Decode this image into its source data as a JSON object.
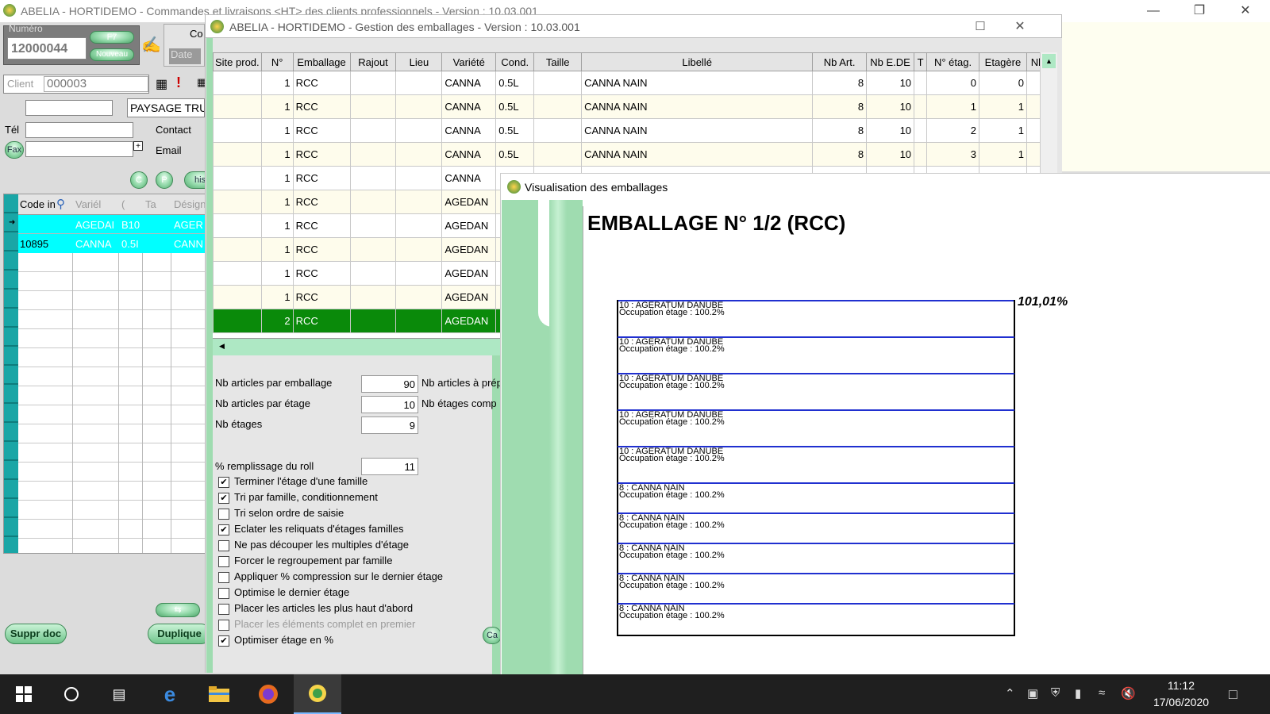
{
  "main_window": {
    "title": "ABELIA  -  HORTIDEMO  -  Commandes et livraisons <HT> des clients professionnels  -  Version : 10.03.001",
    "numero_label": "Numéro",
    "numero_value": "12000044",
    "f7_button": "F7",
    "nouveau_button": "Nouveau",
    "co_label": "Co",
    "date_label": "Date",
    "client_label": "Client",
    "client_value": "000003",
    "client_name": "PAYSAGE TRU",
    "tel_label": "Tél",
    "contact_label": "Contact",
    "fax_label": "Fax",
    "email_label": "Email",
    "c_button": "C",
    "p_button": "P",
    "his_button": "his",
    "grid": {
      "columns": [
        "Code in",
        "Variél",
        "(",
        "Ta",
        "Désign"
      ],
      "rows": [
        [
          "",
          "AGEDAI",
          "B10",
          "",
          "AGER"
        ],
        [
          "10895",
          "CANNA",
          "0.5I",
          "",
          "CANN"
        ]
      ]
    },
    "suppr_button": "Suppr doc",
    "duplique_button": "Duplique"
  },
  "gestion_window": {
    "title": "ABELIA  -  HORTIDEMO  -  Gestion des emballages  -  Version : 10.03.001",
    "columns": [
      "Site prod.",
      "N°",
      "Emballage",
      "Rajout",
      "Lieu",
      "Variété",
      "Cond.",
      "Taille",
      "Libellé",
      "Nb Art.",
      "Nb E.DE",
      "T",
      "N° étag.",
      "Etagère",
      "Nb/e"
    ],
    "rows": [
      {
        "site": "",
        "n": "1",
        "emb": "RCC",
        "rajout": "",
        "lieu": "",
        "var": "CANNA",
        "cond": "0.5L",
        "taille": "",
        "lib": "CANNA NAIN",
        "nbart": "8",
        "nbede": "10",
        "t": "",
        "netag": "0",
        "etag": "0",
        "nbe": ""
      },
      {
        "site": "",
        "n": "1",
        "emb": "RCC",
        "rajout": "",
        "lieu": "",
        "var": "CANNA",
        "cond": "0.5L",
        "taille": "",
        "lib": "CANNA NAIN",
        "nbart": "8",
        "nbede": "10",
        "t": "",
        "netag": "1",
        "etag": "1",
        "nbe": ""
      },
      {
        "site": "",
        "n": "1",
        "emb": "RCC",
        "rajout": "",
        "lieu": "",
        "var": "CANNA",
        "cond": "0.5L",
        "taille": "",
        "lib": "CANNA NAIN",
        "nbart": "8",
        "nbede": "10",
        "t": "",
        "netag": "2",
        "etag": "1",
        "nbe": ""
      },
      {
        "site": "",
        "n": "1",
        "emb": "RCC",
        "rajout": "",
        "lieu": "",
        "var": "CANNA",
        "cond": "0.5L",
        "taille": "",
        "lib": "CANNA NAIN",
        "nbart": "8",
        "nbede": "10",
        "t": "",
        "netag": "3",
        "etag": "1",
        "nbe": ""
      },
      {
        "site": "",
        "n": "1",
        "emb": "RCC",
        "rajout": "",
        "lieu": "",
        "var": "CANNA",
        "cond": "",
        "taille": "",
        "lib": "",
        "nbart": "",
        "nbede": "",
        "t": "",
        "netag": "",
        "etag": "",
        "nbe": ""
      },
      {
        "site": "",
        "n": "1",
        "emb": "RCC",
        "rajout": "",
        "lieu": "",
        "var": "AGEDAN",
        "cond": "",
        "taille": "",
        "lib": "",
        "nbart": "",
        "nbede": "",
        "t": "",
        "netag": "",
        "etag": "",
        "nbe": ""
      },
      {
        "site": "",
        "n": "1",
        "emb": "RCC",
        "rajout": "",
        "lieu": "",
        "var": "AGEDAN",
        "cond": "",
        "taille": "",
        "lib": "",
        "nbart": "",
        "nbede": "",
        "t": "",
        "netag": "",
        "etag": "",
        "nbe": ""
      },
      {
        "site": "",
        "n": "1",
        "emb": "RCC",
        "rajout": "",
        "lieu": "",
        "var": "AGEDAN",
        "cond": "",
        "taille": "",
        "lib": "",
        "nbart": "",
        "nbede": "",
        "t": "",
        "netag": "",
        "etag": "",
        "nbe": ""
      },
      {
        "site": "",
        "n": "1",
        "emb": "RCC",
        "rajout": "",
        "lieu": "",
        "var": "AGEDAN",
        "cond": "",
        "taille": "",
        "lib": "",
        "nbart": "",
        "nbede": "",
        "t": "",
        "netag": "",
        "etag": "",
        "nbe": ""
      },
      {
        "site": "",
        "n": "1",
        "emb": "RCC",
        "rajout": "",
        "lieu": "",
        "var": "AGEDAN",
        "cond": "",
        "taille": "",
        "lib": "",
        "nbart": "",
        "nbede": "",
        "t": "",
        "netag": "",
        "etag": "",
        "nbe": ""
      },
      {
        "site": "",
        "n": "2",
        "emb": "RCC",
        "rajout": "",
        "lieu": "",
        "var": "AGEDAN",
        "cond": "",
        "taille": "",
        "lib": "",
        "nbart": "",
        "nbede": "",
        "t": "",
        "netag": "",
        "etag": "",
        "nbe": ""
      }
    ],
    "params": {
      "nb_articles_par_emballage_label": "Nb articles par emballage",
      "nb_articles_par_emballage": "90",
      "nb_articles_par_etage_label": "Nb articles par étage",
      "nb_articles_par_etage": "10",
      "nb_etages_label": "Nb étages",
      "nb_etages": "9",
      "nb_articles_a_prep_label": "Nb articles à prép",
      "nb_etages_comp_label": "Nb étages comp",
      "remplissage_label": "% remplissage du roll",
      "remplissage": "11"
    },
    "checkboxes": [
      {
        "label": "Terminer l'étage d'une famille",
        "checked": true,
        "disabled": false
      },
      {
        "label": "Tri par famille, conditionnement",
        "checked": true,
        "disabled": false
      },
      {
        "label": "Tri selon ordre de saisie",
        "checked": false,
        "disabled": false
      },
      {
        "label": "Eclater les reliquats d'étages familles",
        "checked": true,
        "disabled": false
      },
      {
        "label": "Ne pas découper les multiples d'étage",
        "checked": false,
        "disabled": false
      },
      {
        "label": "Forcer le regroupement par famille",
        "checked": false,
        "disabled": false
      },
      {
        "label": "Appliquer % compression sur le dernier étage",
        "checked": false,
        "disabled": false
      },
      {
        "label": "Optimise le dernier étage",
        "checked": false,
        "disabled": false
      },
      {
        "label": "Placer les articles les plus haut d'abord",
        "checked": false,
        "disabled": false
      },
      {
        "label": "Placer les éléments complet en premier",
        "checked": false,
        "disabled": true
      },
      {
        "label": "Optimiser étage en %",
        "checked": true,
        "disabled": false
      }
    ],
    "ca_button": "Ca"
  },
  "visualisation_window": {
    "title": "Visualisation des emballages",
    "heading": "EMBALLAGE N° 1/2 (RCC)",
    "percent": "101,01%",
    "shelves": [
      {
        "article": "10 : AGERATUM DANUBE",
        "occupation": "Occupation étage : 100.2%"
      },
      {
        "article": "10 : AGERATUM DANUBE",
        "occupation": "Occupation étage : 100.2%"
      },
      {
        "article": "10 : AGERATUM DANUBE",
        "occupation": "Occupation étage : 100.2%"
      },
      {
        "article": "10 : AGERATUM DANUBE",
        "occupation": "Occupation étage : 100.2%"
      },
      {
        "article": "10 : AGERATUM DANUBE",
        "occupation": "Occupation étage : 100.2%"
      },
      {
        "article": "8 : CANNA NAIN",
        "occupation": "Occupation étage : 100.2%"
      },
      {
        "article": "8 : CANNA NAIN",
        "occupation": "Occupation étage : 100.2%"
      },
      {
        "article": "8 : CANNA NAIN",
        "occupation": "Occupation étage : 100.2%"
      },
      {
        "article": "8 : CANNA NAIN",
        "occupation": "Occupation étage : 100.2%"
      },
      {
        "article": "8 : CANNA NAIN",
        "occupation": "Occupation étage : 100.2%"
      }
    ]
  },
  "taskbar": {
    "time": "11:12",
    "date": "17/06/2020",
    "accent": "#1f1f1f"
  }
}
